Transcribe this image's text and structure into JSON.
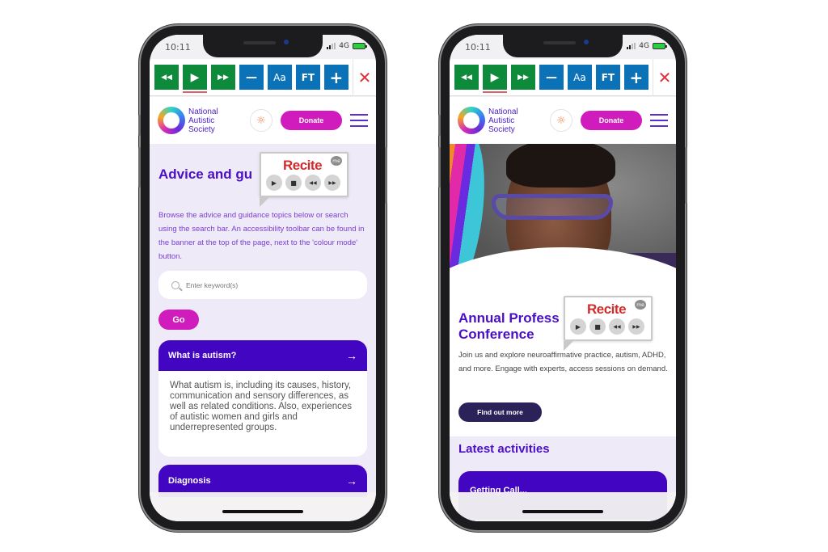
{
  "status_bar": {
    "time": "10:11",
    "network": "4G"
  },
  "toolbar": {
    "buttons": [
      {
        "name": "rewind",
        "glyph": "◀◀"
      },
      {
        "name": "play",
        "glyph": "▶"
      },
      {
        "name": "fast-forward",
        "glyph": "▶▶"
      },
      {
        "name": "decrease-text",
        "glyph": "—"
      },
      {
        "name": "font-settings",
        "glyph": "Aa"
      },
      {
        "name": "font-type",
        "glyph": "FT"
      },
      {
        "name": "increase-text",
        "glyph": "+"
      }
    ],
    "close_glyph": "✕"
  },
  "header": {
    "logo_lines": [
      "National",
      "Autistic",
      "Society"
    ],
    "colour_mode_glyph": "☼",
    "donate_label": "Donate"
  },
  "recite": {
    "brand": "Recite",
    "badge": "me",
    "controls": [
      "▶",
      "■",
      "◀◀",
      "▶▶"
    ]
  },
  "left_page": {
    "title": "Advice and gu",
    "intro": "Browse the advice and guidance topics below or search using the search bar. An accessibility toolbar can be found in the banner at the top of the page, next to the 'colour mode' button.",
    "search_placeholder": "Enter keyword(s)",
    "go_label": "Go",
    "cards": [
      {
        "title": "What is autism?",
        "arrow": "→",
        "body": "What autism is, including its causes, history, communication and sensory differences, as well as related conditions. Also, experiences of autistic women and girls and underrepresented groups."
      },
      {
        "title": "Diagnosis",
        "arrow": "→"
      }
    ]
  },
  "right_page": {
    "title_line1": "Annual Profess",
    "title_line2": "Conference",
    "body": "Join us and explore neuroaffirmative practice, autism, ADHD, and more. Engage with experts, access sessions on demand.",
    "cta_label": "Find out more",
    "latest_title": "Latest activities",
    "activity_card_title": "Getting Call..."
  }
}
